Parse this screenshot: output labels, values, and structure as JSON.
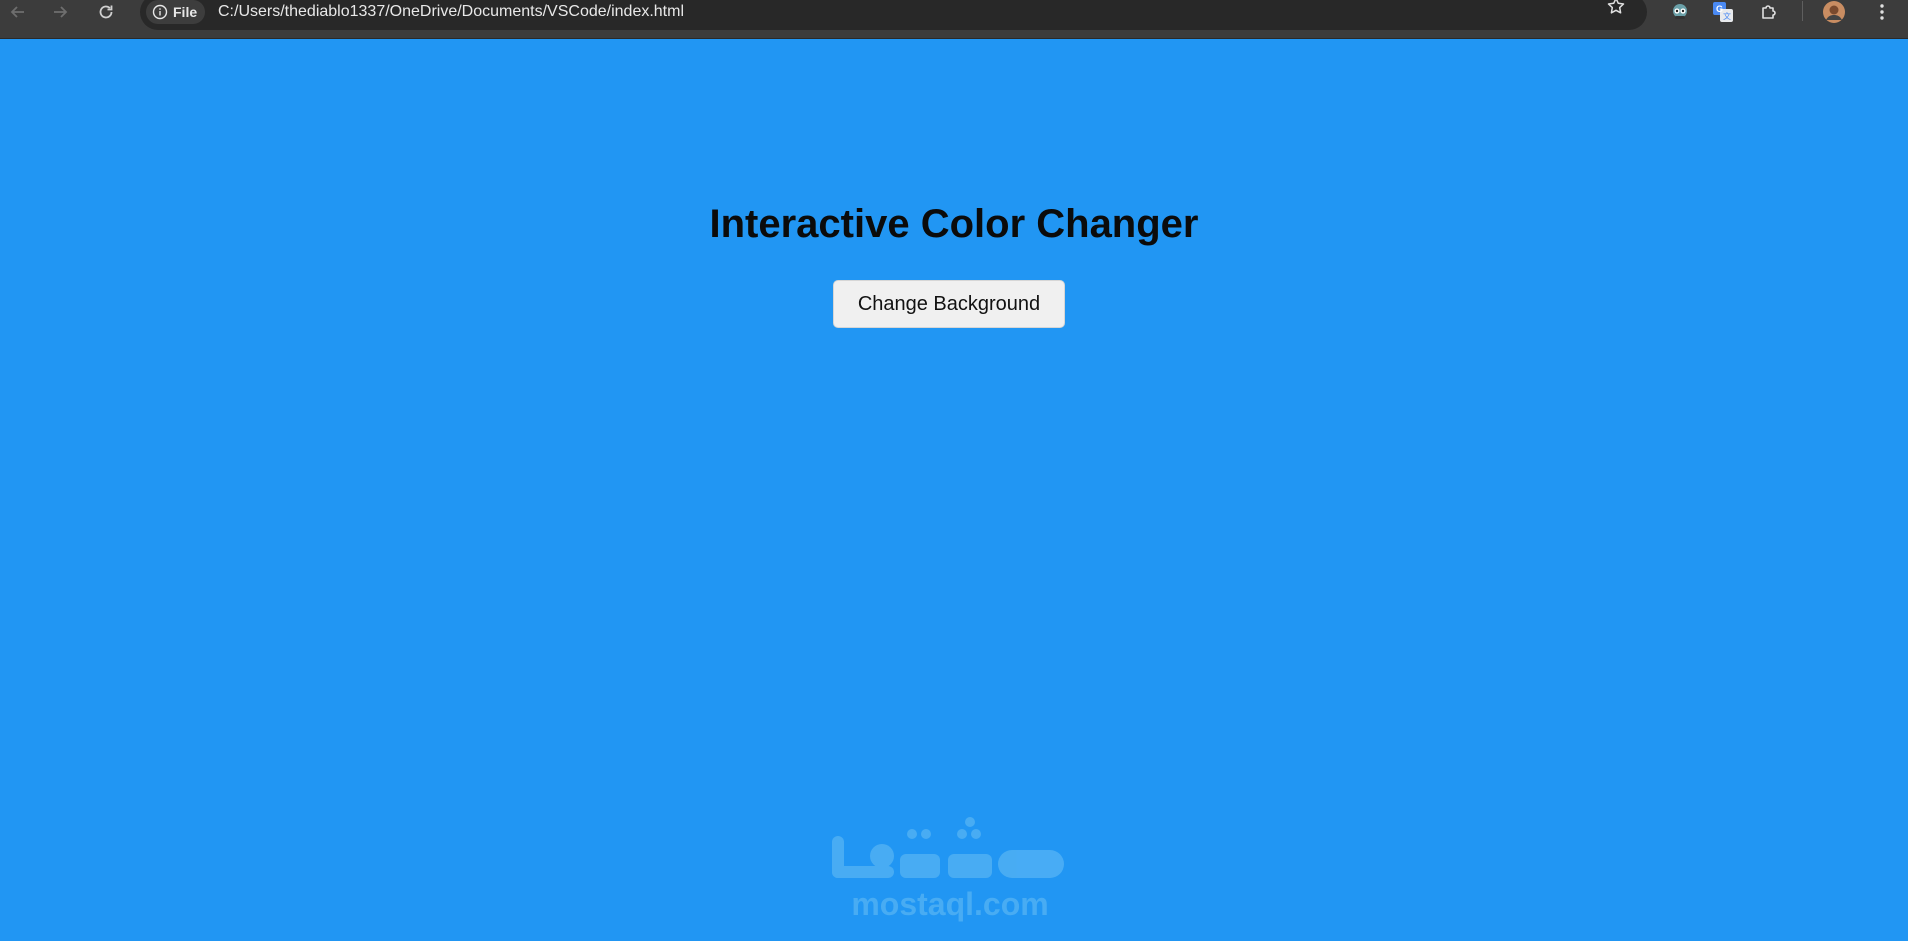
{
  "browser": {
    "back_icon": "arrow-left-icon",
    "forward_icon": "arrow-right-icon",
    "reload_icon": "reload-icon",
    "chip_label": "File",
    "url": "C:/Users/thediablo1337/OneDrive/Documents/VSCode/index.html",
    "toolbar_icons": [
      "star-icon",
      "extension-icon",
      "translate-icon",
      "puzzle-icon",
      "avatar",
      "menu-icon"
    ]
  },
  "page": {
    "background_color": "#2196f3",
    "title": "Interactive Color Changer",
    "button_label": "Change Background"
  },
  "watermark": {
    "text": "mostaql.com",
    "logo_text": "مستقل"
  }
}
